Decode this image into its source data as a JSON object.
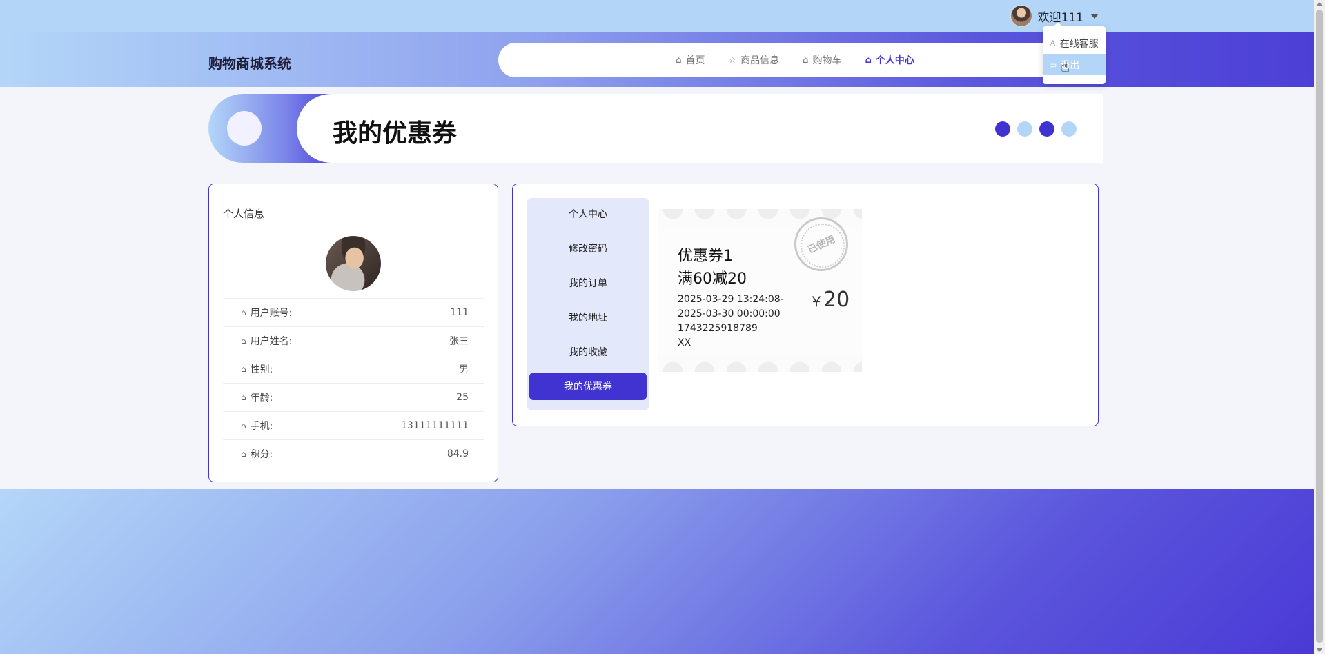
{
  "user": {
    "welcome": "欢迎111"
  },
  "dropdown": {
    "items": [
      "在线客服",
      "退出"
    ]
  },
  "header": {
    "site_title": "购物商城系统"
  },
  "nav": {
    "items": [
      "首页",
      "商品信息",
      "购物车",
      "个人中心"
    ],
    "active": "个人中心"
  },
  "banner": {
    "title": "我的优惠券"
  },
  "profile": {
    "title": "个人信息",
    "rows": [
      {
        "label": "用户账号:",
        "value": "111"
      },
      {
        "label": "用户姓名:",
        "value": "张三"
      },
      {
        "label": "性别:",
        "value": "男"
      },
      {
        "label": "年龄:",
        "value": "25"
      },
      {
        "label": "手机:",
        "value": "13111111111"
      },
      {
        "label": "积分:",
        "value": "84.9"
      }
    ]
  },
  "side_menu": {
    "items": [
      "个人中心",
      "修改密码",
      "我的订单",
      "我的地址",
      "我的收藏",
      "我的优惠券"
    ],
    "active": "我的优惠券"
  },
  "coupon": {
    "name": "优惠券1",
    "rule": "满60减20",
    "time": "2025-03-29 13:24:08-2025-03-30 00:00:00",
    "code": "1743225918789",
    "extra": "XX",
    "currency": "￥",
    "amount": "20",
    "stamp": "已使用"
  },
  "colors": {
    "accent": "#4033d2",
    "light": "#b3d6f8"
  }
}
